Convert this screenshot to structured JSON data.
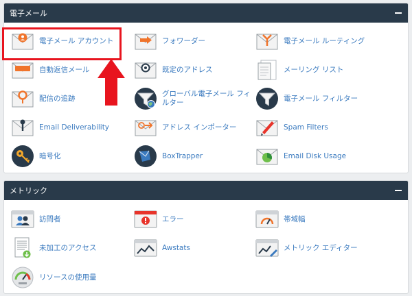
{
  "email_section": {
    "title": "電子メール",
    "items": [
      {
        "label": "電子メール アカウント",
        "icon": "email-accounts-icon"
      },
      {
        "label": "フォワーダー",
        "icon": "forwarders-icon"
      },
      {
        "label": "電子メール ルーティング",
        "icon": "email-routing-icon"
      },
      {
        "label": "自動返信メール",
        "icon": "autoresponders-icon"
      },
      {
        "label": "既定のアドレス",
        "icon": "default-address-icon"
      },
      {
        "label": "メーリング リスト",
        "icon": "mailing-lists-icon"
      },
      {
        "label": "配信の追跡",
        "icon": "track-delivery-icon"
      },
      {
        "label": "グローバル電子メール フィルター",
        "icon": "global-email-filters-icon"
      },
      {
        "label": "電子メール フィルター",
        "icon": "email-filters-icon"
      },
      {
        "label": "Email Deliverability",
        "icon": "email-deliverability-icon"
      },
      {
        "label": "アドレス インポーター",
        "icon": "address-importer-icon"
      },
      {
        "label": "Spam Filters",
        "icon": "spam-filters-icon"
      },
      {
        "label": "暗号化",
        "icon": "encryption-icon"
      },
      {
        "label": "BoxTrapper",
        "icon": "boxtrapper-icon"
      },
      {
        "label": "Email Disk Usage",
        "icon": "email-disk-usage-icon"
      }
    ]
  },
  "metrics_section": {
    "title": "メトリック",
    "items": [
      {
        "label": "訪問者",
        "icon": "visitors-icon"
      },
      {
        "label": "エラー",
        "icon": "errors-icon"
      },
      {
        "label": "帯域幅",
        "icon": "bandwidth-icon"
      },
      {
        "label": "未加工のアクセス",
        "icon": "raw-access-icon"
      },
      {
        "label": "Awstats",
        "icon": "awstats-icon"
      },
      {
        "label": "メトリック エディター",
        "icon": "metrics-editor-icon"
      },
      {
        "label": "リソースの使用量",
        "icon": "resource-usage-icon"
      }
    ]
  },
  "annotation": {
    "arrow_color": "#e8141e"
  }
}
